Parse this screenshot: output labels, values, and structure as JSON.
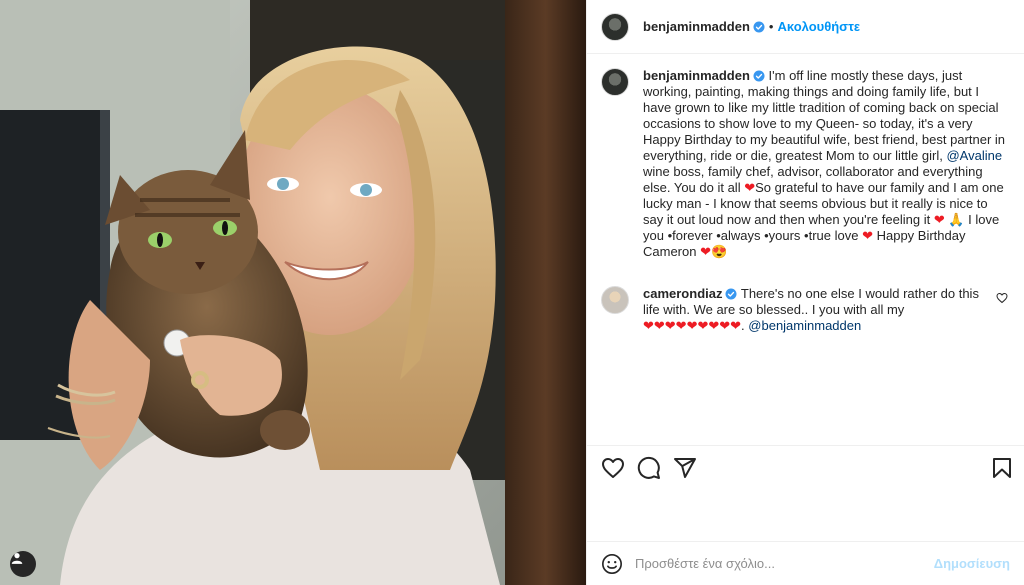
{
  "header": {
    "username": "benjaminmadden",
    "separator": "•",
    "follow_label": "Ακολουθήστε"
  },
  "caption": {
    "username": "benjaminmadden",
    "text_1": "I'm off line mostly these days, just working, painting, making things and doing family life, but I have grown to like my little tradition of coming back on special occasions to show love to my Queen- so today, it's a very Happy Birthday to my beautiful wife, best friend, best partner in everything, ride or die, greatest Mom to our little girl, ",
    "mention_1": "@Avaline",
    "text_2": " wine boss, family chef, advisor, collaborator and everything else. You do it all ",
    "heart_1": "❤",
    "text_3": "So grateful to have our family and I am one lucky man - I know that seems obvious but it really is nice to say it out loud now and then when you're feeling it ",
    "heart_2": "❤",
    "pray": "🙏",
    "text_4": " I love you •forever •always •yours •true love ",
    "heart_3": "❤",
    "text_5": " Happy Birthday Cameron ",
    "heart_4": "❤",
    "heart_eyes": "😍"
  },
  "reply": {
    "username": "camerondiaz",
    "text_1": "There's no one else I would rather do this life with. We are so blessed.. I you with all my",
    "hearts": "❤❤❤❤❤❤❤❤❤",
    "text_2": ". ",
    "mention": "@benjaminmadden"
  },
  "add_comment": {
    "placeholder": "Προσθέστε ένα σχόλιο...",
    "post_label": "Δημοσίευση"
  },
  "icons": {
    "verified": "verified-badge-icon",
    "like": "heart-outline-icon",
    "comment": "comment-bubble-icon",
    "share": "paper-plane-icon",
    "save": "bookmark-icon",
    "emoji": "smiley-icon",
    "tag": "user-tag-icon"
  },
  "colors": {
    "accent": "#0095f6",
    "verified": "#3897f0",
    "mention": "#00376b",
    "heart": "#ed1c24",
    "post_disabled": "#b2dffc"
  }
}
